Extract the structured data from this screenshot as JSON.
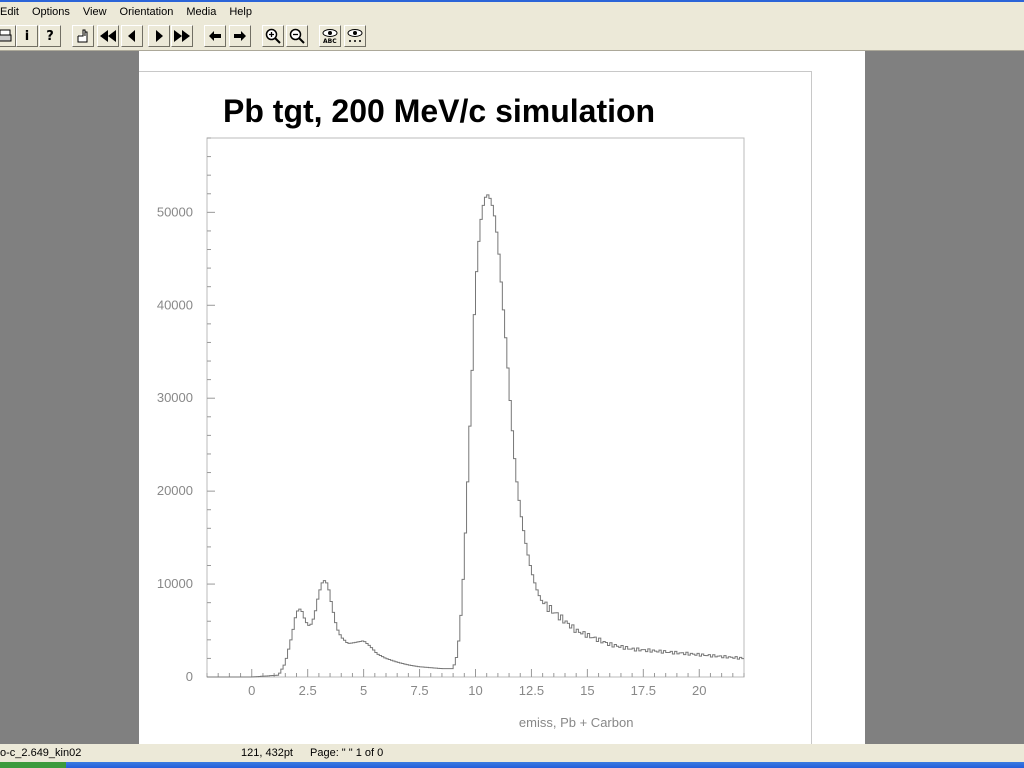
{
  "menu": [
    "Edit",
    "Options",
    "View",
    "Orientation",
    "Media",
    "Help"
  ],
  "toolbar": {
    "info_label": "i",
    "help_label": "?",
    "buttons": [
      "print-icon",
      "info-icon",
      "help-icon",
      "hand-icon",
      "first-page-icon",
      "prev-page-icon",
      "next-page-icon",
      "last-page-icon",
      "back-arrow-icon",
      "forward-arrow-icon",
      "zoom-in-icon",
      "zoom-out-icon",
      "eye-abc-icon",
      "eye-dots-icon"
    ]
  },
  "page": {
    "title": "Pb tgt, 200 MeV/c simulation"
  },
  "chart_data": {
    "type": "line",
    "title": "",
    "xlabel": "emiss, Pb + Carbon",
    "ylabel": "",
    "xlim": [
      -2,
      22
    ],
    "ylim": [
      0,
      58000
    ],
    "xticks": [
      "0",
      "2.5",
      "5",
      "7.5",
      "10",
      "12.5",
      "15",
      "17.5",
      "20"
    ],
    "xtick_values": [
      0,
      2.5,
      5,
      7.5,
      10,
      12.5,
      15,
      17.5,
      20
    ],
    "yticks": [
      "0",
      "10000",
      "20000",
      "30000",
      "40000",
      "50000"
    ],
    "ytick_values": [
      0,
      10000,
      20000,
      30000,
      40000,
      50000
    ],
    "grid": false,
    "series": [
      {
        "x": [
          -2,
          0,
          1.2,
          1.5,
          1.8,
          2.0,
          2.2,
          2.4,
          2.6,
          2.8,
          3.0,
          3.2,
          3.4,
          3.6,
          3.8,
          4.0,
          4.3,
          4.6,
          5.0,
          5.3,
          5.6,
          6.0,
          6.5,
          7.0,
          7.5,
          8.0,
          8.5,
          9.0,
          9.2,
          9.4,
          9.6,
          9.8,
          10.0,
          10.2,
          10.4,
          10.6,
          10.7,
          10.8,
          11.0,
          11.2,
          11.4,
          11.6,
          11.8,
          12.0,
          12.2,
          12.4,
          12.6,
          12.8,
          13.0,
          13.5,
          14.0,
          14.5,
          15.0,
          15.5,
          16.0,
          17.0,
          18.0,
          19.0,
          20.0,
          21.0,
          22.0
        ],
        "y": [
          0,
          0,
          200,
          1500,
          4500,
          7000,
          7400,
          6000,
          5400,
          6500,
          9000,
          10500,
          10000,
          7500,
          5300,
          4300,
          3600,
          3700,
          3900,
          3300,
          2500,
          2000,
          1600,
          1300,
          1100,
          1000,
          900,
          900,
          2500,
          8000,
          18000,
          30000,
          42000,
          48500,
          51500,
          52000,
          51000,
          50500,
          47000,
          41000,
          35000,
          28000,
          22000,
          18000,
          15000,
          12500,
          10500,
          9000,
          8000,
          7000,
          6000,
          5000,
          4500,
          4000,
          3500,
          3000,
          2800,
          2600,
          2400,
          2200,
          2000
        ]
      }
    ]
  },
  "status": {
    "filename": "o-c_2.649_kin02",
    "coords": "121, 432pt",
    "page_info": "Page: \" \"  1 of 0"
  }
}
